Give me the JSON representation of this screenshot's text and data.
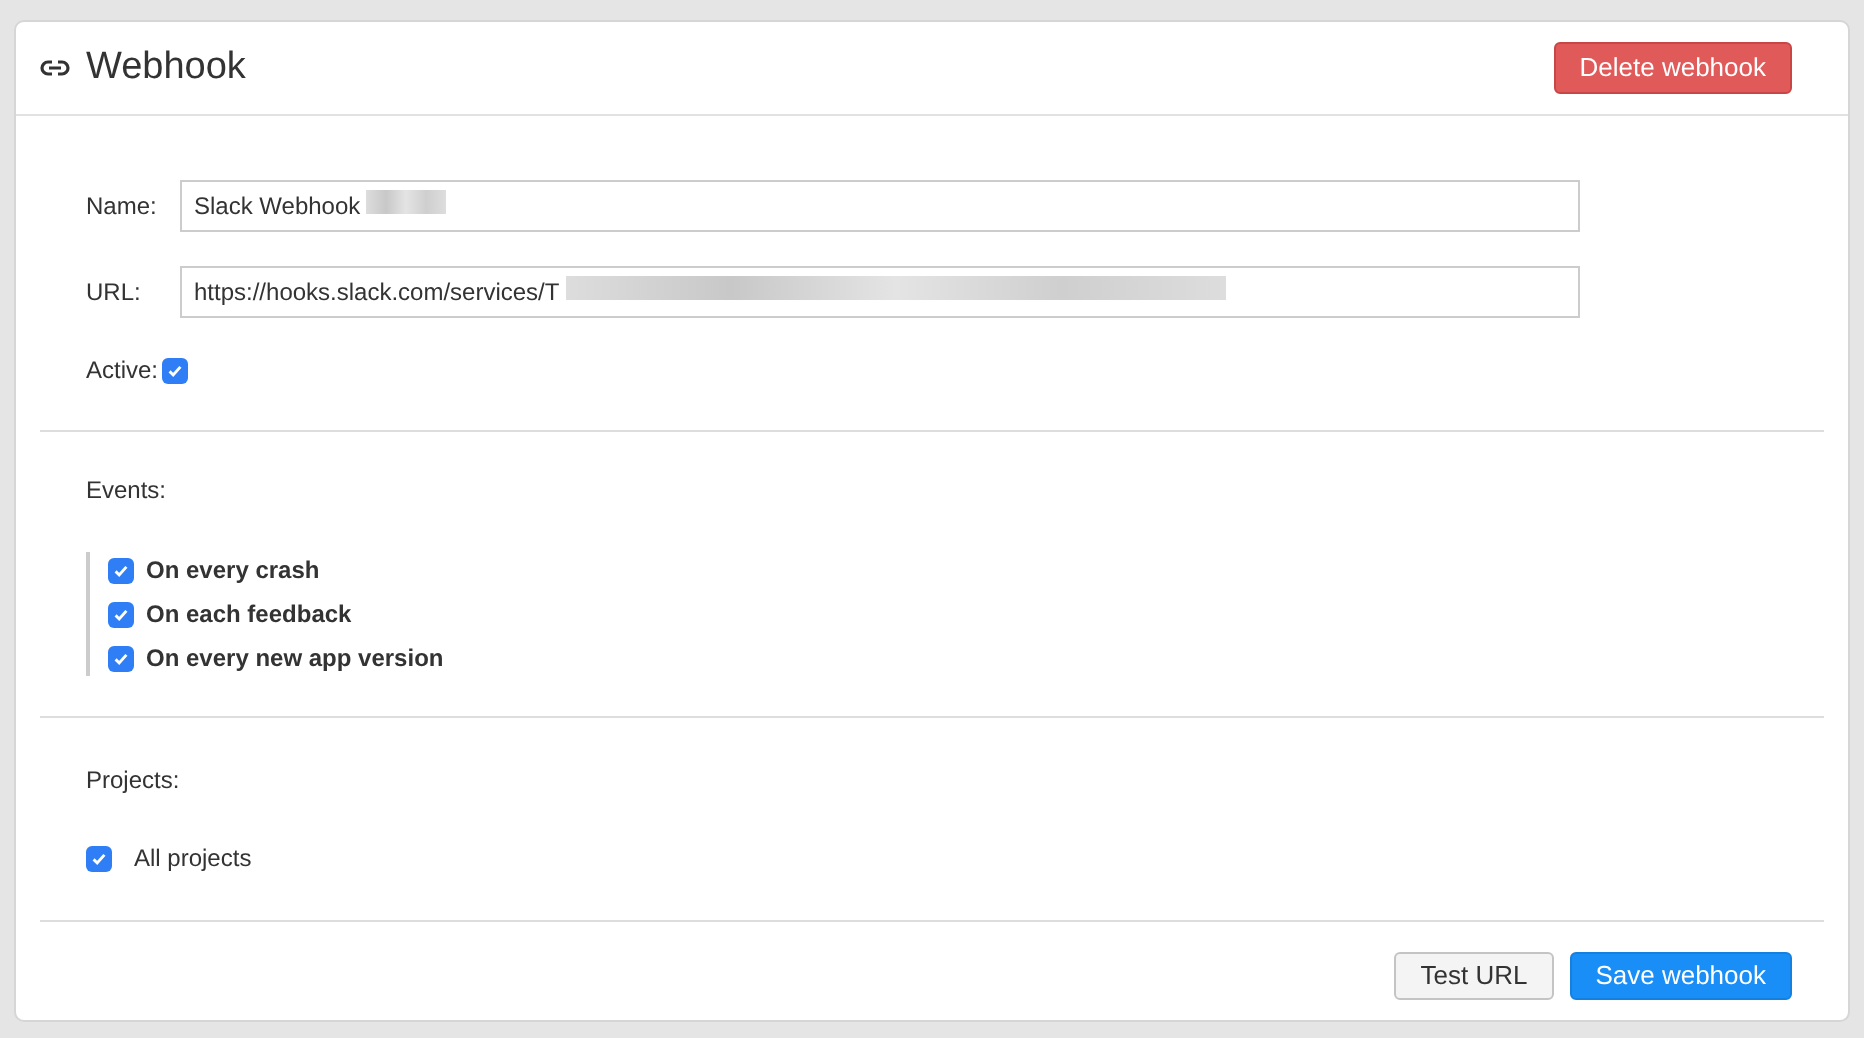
{
  "header": {
    "title": "Webhook",
    "delete_button": "Delete webhook"
  },
  "fields": [
    {
      "label": "Name:",
      "value": "Slack Webhook",
      "redacted": true
    },
    {
      "label": "URL:",
      "value": "https://hooks.slack.com/services/T",
      "redacted": true
    }
  ],
  "active": {
    "label": "Active:",
    "checked": true
  },
  "events": {
    "label": "Events:",
    "items": [
      {
        "label": "On every crash",
        "checked": true
      },
      {
        "label": "On each feedback",
        "checked": true
      },
      {
        "label": "On every new app version",
        "checked": true
      }
    ]
  },
  "projects": {
    "label": "Projects:",
    "items": [
      {
        "label": "All projects",
        "checked": true
      }
    ]
  },
  "footer": {
    "buttons": [
      {
        "label": "Test URL",
        "kind": "secondary"
      },
      {
        "label": "Save webhook",
        "kind": "primary"
      }
    ]
  }
}
